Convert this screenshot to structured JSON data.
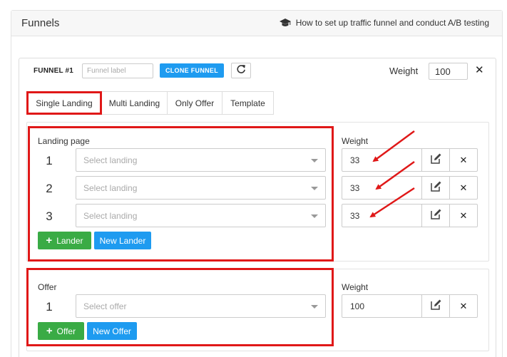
{
  "header": {
    "title": "Funnels",
    "help_icon": "graduation-cap-icon",
    "help_link": "How to set up traffic funnel and conduct A/B testing"
  },
  "funnel": {
    "number_label": "FUNNEL #1",
    "label_placeholder": "Funnel label",
    "clone_button": "CLONE FUNNEL",
    "refresh_icon": "refresh-icon",
    "weight_label": "Weight",
    "weight_value": "100",
    "remove_icon": "close-icon"
  },
  "tabs": [
    {
      "label": "Single Landing",
      "active": true
    },
    {
      "label": "Multi Landing",
      "active": false
    },
    {
      "label": "Only Offer",
      "active": false
    },
    {
      "label": "Template",
      "active": false
    }
  ],
  "landing": {
    "section_label": "Landing page",
    "weight_label": "Weight",
    "rows": [
      {
        "num": "1",
        "placeholder": "Select landing",
        "weight": "33"
      },
      {
        "num": "2",
        "placeholder": "Select landing",
        "weight": "33"
      },
      {
        "num": "3",
        "placeholder": "Select landing",
        "weight": "33"
      }
    ],
    "add_button": "Lander",
    "new_button": "New Lander"
  },
  "offer": {
    "section_label": "Offer",
    "weight_label": "Weight",
    "rows": [
      {
        "num": "1",
        "placeholder": "Select offer",
        "weight": "100"
      }
    ],
    "add_button": "Offer",
    "new_button": "New Offer"
  },
  "colors": {
    "primary_blue": "#1e9bf0",
    "success_green": "#3aab45",
    "highlight_red": "#e01818",
    "header_bg": "#f7f7f7"
  }
}
